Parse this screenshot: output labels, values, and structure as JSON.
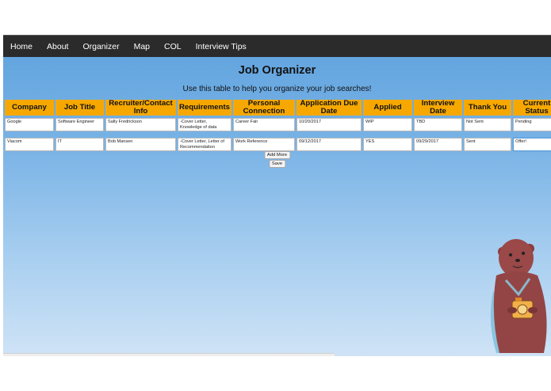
{
  "nav": [
    "Home",
    "About",
    "Organizer",
    "Map",
    "COL",
    "Interview Tips"
  ],
  "page": {
    "title": "Job Organizer",
    "subtitle": "Use this table to help you organize your job searches!"
  },
  "table": {
    "headers": [
      "Company",
      "Job Title",
      "Recruiter/Contact Info",
      "Requirements",
      "Personal Connection",
      "Application Due Date",
      "Applied",
      "Interview Date",
      "Thank You",
      "Current Status"
    ],
    "rows": [
      [
        "Google",
        "Software Engineer",
        "Sally Fredrickson",
        "-Cover Letter, Knowledge of data",
        "Career Fair",
        "10/20/2017",
        "WIP",
        "TBD",
        "Not Sent",
        "Pending"
      ],
      [
        "Viacom",
        "IT",
        "Bob Mansen",
        "-Cover Letter, Letter of Recommendation",
        "Work Reference",
        "09/12/2017",
        "YES",
        "09/29/2017",
        "Sent",
        "Offer!"
      ]
    ]
  },
  "buttons": {
    "add_more": "Add More",
    "save": "Save"
  },
  "colors": {
    "header_bg": "#f6a800",
    "navbar_bg": "#2b2b2b",
    "sky_top": "#5fa2de"
  },
  "mascot": "otter-with-camera-icon"
}
